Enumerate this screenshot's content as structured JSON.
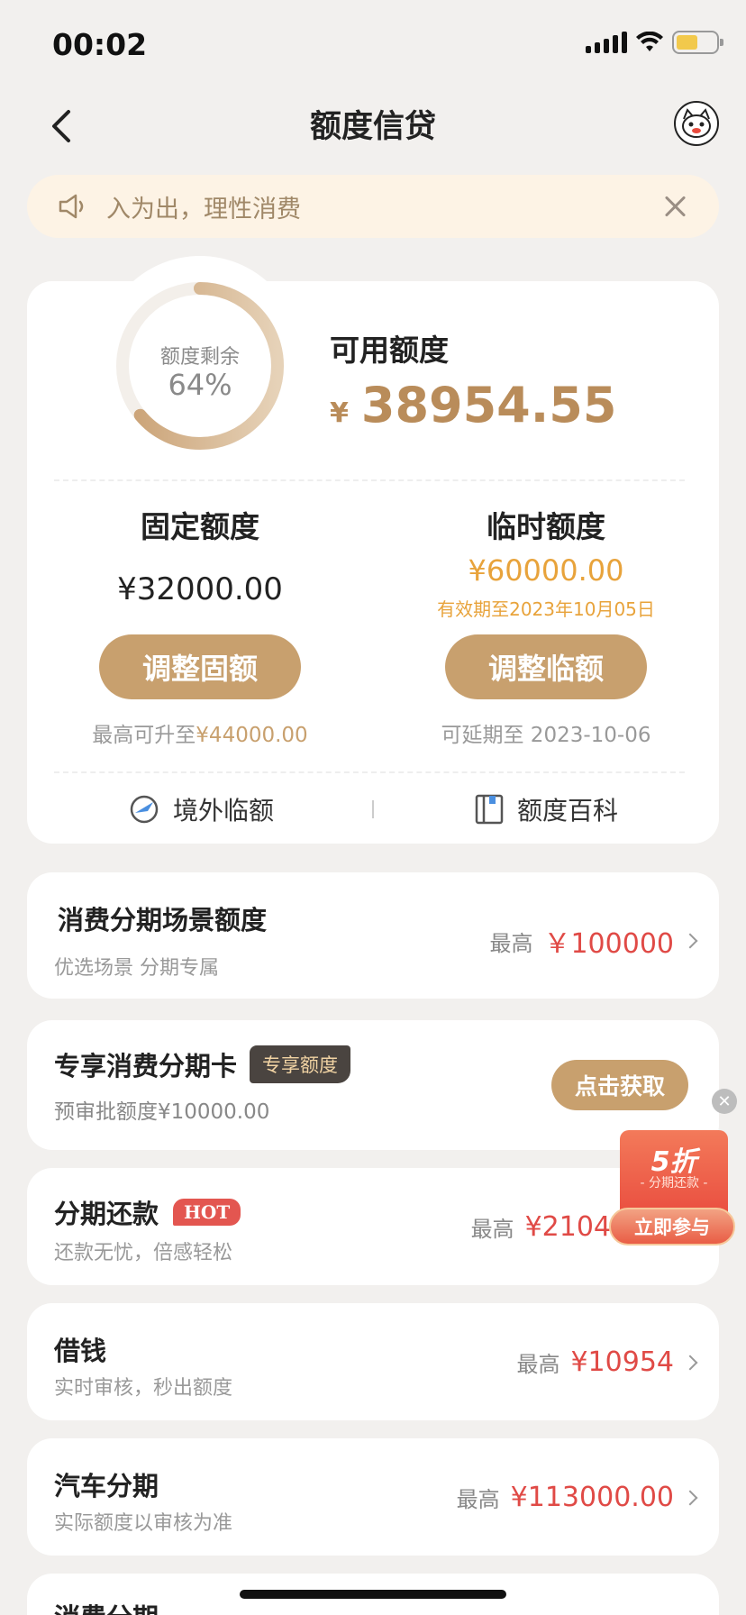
{
  "status_bar": {
    "time": "00:02"
  },
  "nav": {
    "title": "额度信贷"
  },
  "notice": {
    "text": "入为出，理性消费"
  },
  "credit": {
    "ring_label": "额度剩余",
    "ring_percent": "64%",
    "remaining_fraction": 0.64,
    "available_title": "可用额度",
    "available_currency": "¥",
    "available_amount": "38954.55",
    "fixed": {
      "title": "固定额度",
      "amount": "¥32000.00",
      "button": "调整固额",
      "note_prefix": "最高可升至",
      "note_value": "¥44000.00"
    },
    "temp": {
      "title": "临时额度",
      "amount": "¥60000.00",
      "valid": "有效期至2023年10月05日",
      "button": "调整临额",
      "note": "可延期至 2023-10-06"
    },
    "links": {
      "overseas": "境外临额",
      "encyclopedia": "额度百科"
    }
  },
  "items": {
    "scene": {
      "title": "消费分期场景额度",
      "sub": "优选场景 分期专属",
      "prefix": "最高",
      "amount": "￥100000"
    },
    "card": {
      "title": "专享消费分期卡",
      "tag": "专享额度",
      "sub": "预审批额度¥10000.00",
      "button": "点击获取"
    },
    "install": {
      "title": "分期还款",
      "tag": "HOT",
      "sub": "还款无忧，倍感轻松",
      "prefix": "最高",
      "amount": "¥2104"
    },
    "loan": {
      "title": "借钱",
      "sub": "实时审核，秒出额度",
      "prefix": "最高",
      "amount": "¥10954"
    },
    "car": {
      "title": "汽车分期",
      "sub": "实际额度以审核为准",
      "prefix": "最高",
      "amount": "¥113000.00"
    },
    "consume": {
      "title": "消费分期"
    }
  },
  "promo": {
    "big": "5折",
    "small": "- 分期还款 -",
    "button": "立即参与"
  },
  "colors": {
    "gold": "#c8a06e",
    "red": "#e04a46",
    "orange": "#e8a33b"
  }
}
